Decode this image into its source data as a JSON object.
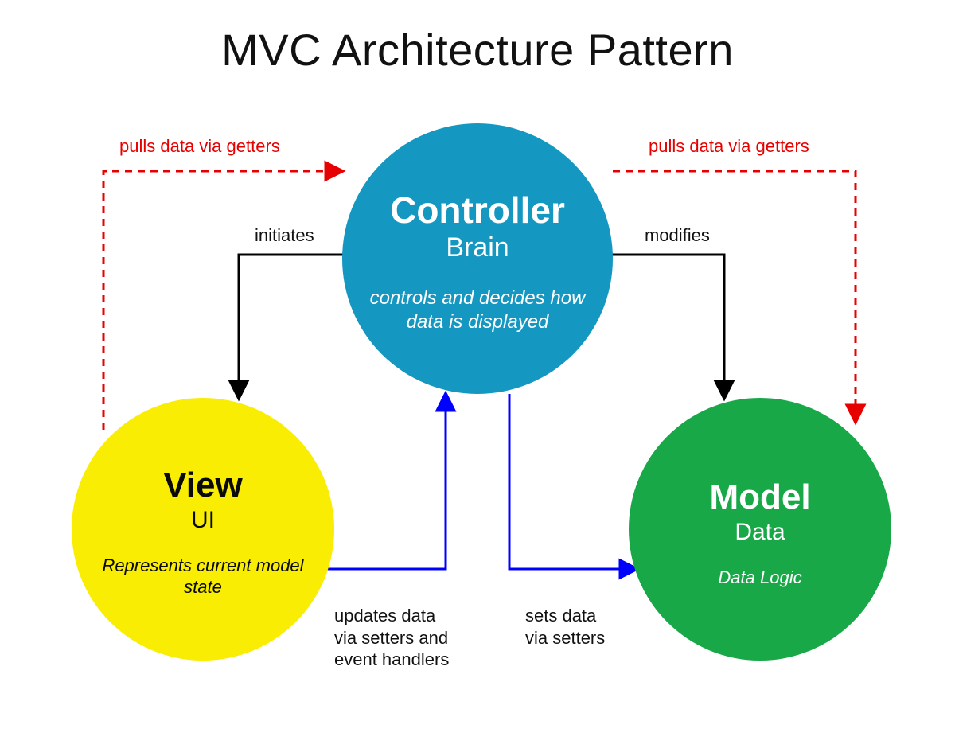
{
  "title": "MVC Architecture Pattern",
  "nodes": {
    "controller": {
      "title": "Controller",
      "subtitle": "Brain",
      "description": "controls and decides how data is displayed",
      "color": "#1497c1",
      "text_color": "#ffffff"
    },
    "view": {
      "title": "View",
      "subtitle": "UI",
      "description": "Represents current model state",
      "color": "#f8ed03",
      "text_color": "#0a0a0a"
    },
    "model": {
      "title": "Model",
      "subtitle": "Data",
      "description": "Data Logic",
      "color": "#18a848",
      "text_color": "#ffffff"
    }
  },
  "edges": {
    "view_to_controller_pull": {
      "label": "pulls data via getters",
      "from": "view",
      "to": "controller",
      "style": "dashed",
      "color": "#e60000"
    },
    "controller_to_view_initiates": {
      "label": "initiates",
      "from": "controller",
      "to": "view",
      "style": "solid",
      "color": "#000000"
    },
    "view_to_controller_updates": {
      "label": "updates data via setters and event handlers",
      "from": "view",
      "to": "controller",
      "style": "solid",
      "color": "#0000ff"
    },
    "controller_to_model_sets": {
      "label": "sets data via setters",
      "from": "controller",
      "to": "model",
      "style": "solid",
      "color": "#0000ff"
    },
    "controller_to_model_modifies": {
      "label": "modifies",
      "from": "controller",
      "to": "model",
      "style": "solid",
      "color": "#000000"
    },
    "controller_to_model_pull": {
      "label": "pulls data via getters",
      "from": "controller",
      "to": "model",
      "style": "dashed",
      "color": "#e60000"
    }
  },
  "labels": {
    "pull_left": "pulls data via getters",
    "pull_right": "pulls data via getters",
    "initiates": "initiates",
    "modifies": "modifies",
    "updates": "updates data\nvia setters and\nevent handlers",
    "sets": "sets data\nvia setters"
  }
}
